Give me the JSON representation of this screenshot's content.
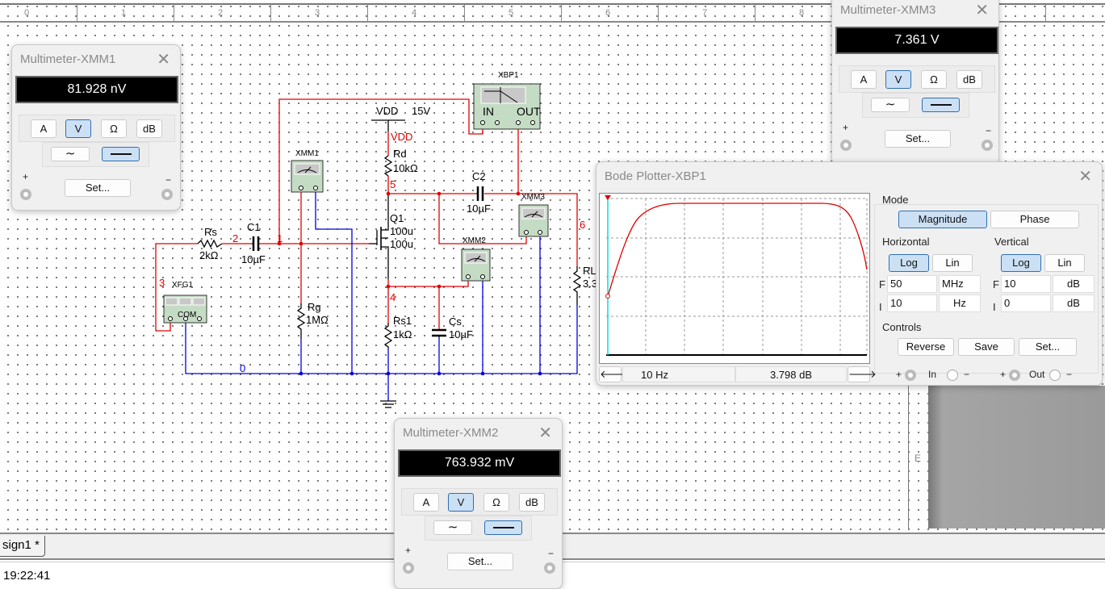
{
  "ruler": {
    "labels": [
      "0",
      "1",
      "2",
      "3",
      "4",
      "5",
      "6",
      "7",
      "8"
    ]
  },
  "side_ruler_label": "E",
  "circuit": {
    "labels": {
      "vdd": "VDD",
      "vdd_value": "15V",
      "vdd_net": "VDD",
      "rd": "Rd",
      "rd_value": "10kΩ",
      "rs": "Rs",
      "rs_value": "2kΩ",
      "c1": "C1",
      "c1_value": "10µF",
      "c2": "C2",
      "c2_value": "10µF",
      "q1": "Q1",
      "q1_w": "100u",
      "q1_l": "100u",
      "rg": "Rg",
      "rg_value": "1MΩ",
      "rs1": "Rs1",
      "rs1_value": "1kΩ",
      "cs": "Cs",
      "cs_value": "10µF",
      "rl": "RL",
      "rl_value": "3.3",
      "xmm1": "XMM1",
      "xmm2": "XMM2",
      "xmm3": "XMM3",
      "xfg1": "XFG1",
      "xfg_com": "COM",
      "xbp1": "XBP1",
      "xbp_in": "IN",
      "xbp_out": "OUT",
      "net1": "1",
      "net2": "2",
      "net3": "3",
      "net4": "4",
      "net5": "5",
      "net6": "6",
      "net0": "0"
    },
    "colors": {
      "signal_wire": "#e00000",
      "ground_wire": "#0000e0",
      "instrument": "#c4dcc4"
    }
  },
  "multimeters": {
    "xmm1": {
      "title": "Multimeter-XMM1",
      "reading": "81.928 nV",
      "mode": "V",
      "coupling": "DC"
    },
    "xmm2": {
      "title": "Multimeter-XMM2",
      "reading": "763.932 mV",
      "mode": "V",
      "coupling": "DC"
    },
    "xmm3": {
      "title": "Multimeter-XMM3",
      "reading": "7.361 V",
      "mode": "V",
      "coupling": "DC"
    }
  },
  "multimeter_buttons": {
    "a": "A",
    "v": "V",
    "ohm": "Ω",
    "db": "dB",
    "set": "Set...",
    "plus": "+",
    "minus": "−"
  },
  "bode": {
    "title": "Bode Plotter-XBP1",
    "mode_label": "Mode",
    "magnitude": "Magnitude",
    "phase": "Phase",
    "mode_selected": "Magnitude",
    "horizontal_label": "Horizontal",
    "vertical_label": "Vertical",
    "log": "Log",
    "lin": "Lin",
    "horizontal_scale": "Log",
    "vertical_scale": "Log",
    "f_label": "F",
    "i_label": "I",
    "h_final_value": "50",
    "h_final_unit": "MHz",
    "h_initial_value": "10",
    "h_initial_unit": "Hz",
    "v_final_value": "10",
    "v_final_unit": "dB",
    "v_initial_value": "0",
    "v_initial_unit": "dB",
    "controls_label": "Controls",
    "reverse": "Reverse",
    "save": "Save",
    "set": "Set...",
    "cursor_freq": "10  Hz",
    "cursor_value": "3.798 dB",
    "plus": "+",
    "minus": "−",
    "in_label": "In",
    "out_label": "Out",
    "curve_color": "#e00000",
    "cursor_color": "#00e0e0"
  },
  "tab": {
    "label": "sign1 *"
  },
  "status": {
    "time": "19:22:41"
  }
}
